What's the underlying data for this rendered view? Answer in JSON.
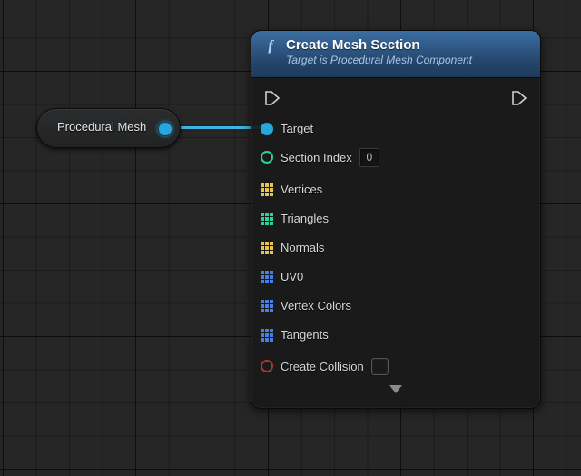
{
  "variable_node": {
    "label": "Procedural Mesh"
  },
  "function_node": {
    "title": "Create Mesh Section",
    "subtitle": "Target is Procedural Mesh Component",
    "pins": {
      "target": "Target",
      "section_index": "Section Index",
      "section_index_value": "0",
      "vertices": "Vertices",
      "triangles": "Triangles",
      "normals": "Normals",
      "uv0": "UV0",
      "vertex_colors": "Vertex Colors",
      "tangents": "Tangents",
      "create_collision": "Create Collision"
    }
  }
}
